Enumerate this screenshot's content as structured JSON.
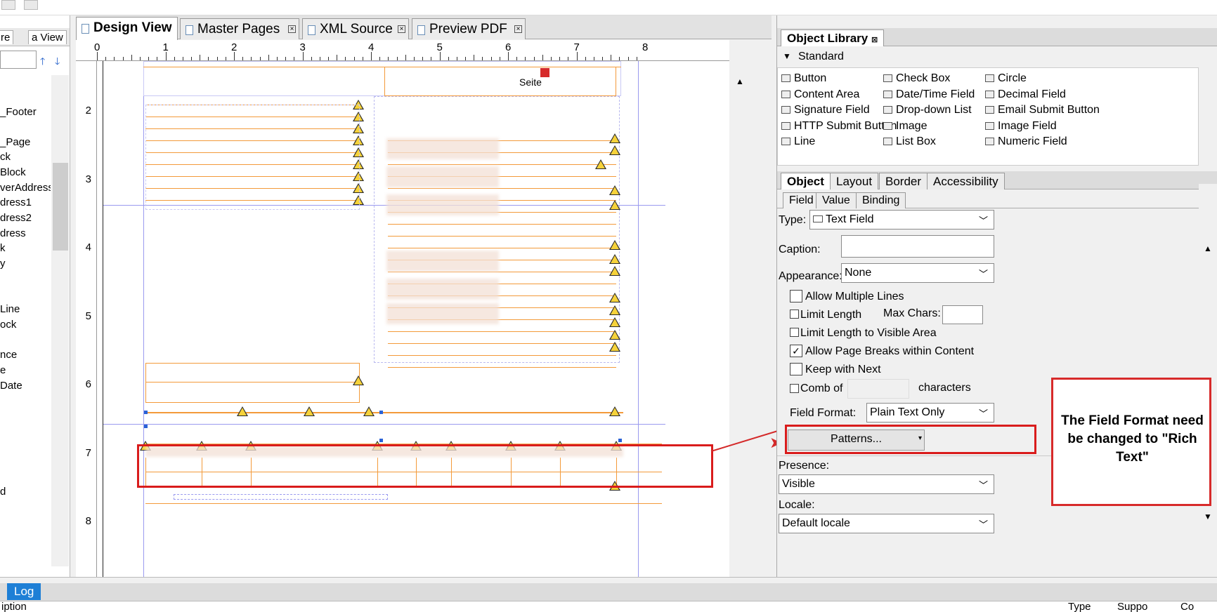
{
  "left_panel": {
    "tabs": [
      "re",
      "a View"
    ],
    "items": [
      "_Footer",
      "_Page",
      "ck",
      "Block",
      "verAddress",
      "dress1",
      "dress2",
      "dress",
      "k",
      "y",
      "Line",
      "ock",
      "nce",
      "e",
      "Date",
      "d"
    ]
  },
  "tabs": [
    {
      "label": "Design View",
      "active": true
    },
    {
      "label": "Master Pages",
      "active": false
    },
    {
      "label": "XML Source",
      "active": false
    },
    {
      "label": "Preview PDF",
      "active": false
    }
  ],
  "ruler": {
    "horizontal": [
      "0",
      "1",
      "2",
      "3",
      "4",
      "5",
      "6",
      "7",
      "8"
    ],
    "vertical": [
      "2",
      "3",
      "4",
      "5",
      "6",
      "7",
      "8"
    ]
  },
  "canvas": {
    "page_label": "Seite"
  },
  "callout": {
    "text": "The Field Format need be changed to \"Rich Text\""
  },
  "object_library": {
    "title": "Object Library",
    "section": "Standard",
    "items": [
      [
        "Button",
        "Check Box",
        "Circle"
      ],
      [
        "Content Area",
        "Date/Time Field",
        "Decimal Field"
      ],
      [
        "Signature Field",
        "Drop-down List",
        "Email Submit Button"
      ],
      [
        "HTTP Submit Button",
        "Image",
        "Image Field"
      ],
      [
        "Line",
        "List Box",
        "Numeric Field"
      ]
    ]
  },
  "object_panel": {
    "tabs": [
      "Object",
      "Layout",
      "Border",
      "Accessibility"
    ],
    "subtabs": [
      "Field",
      "Value",
      "Binding"
    ],
    "type_label": "Type:",
    "type_value": "Text Field",
    "caption_label": "Caption:",
    "caption_value": "",
    "appearance_label": "Appearance:",
    "appearance_value": "None",
    "allow_multiple_lines": {
      "label": "Allow Multiple Lines",
      "checked": false
    },
    "limit_length": {
      "label": "Limit Length",
      "checked": false
    },
    "max_chars_label": "Max Chars:",
    "max_chars_value": "",
    "limit_visible": {
      "label": "Limit Length to Visible Area",
      "checked": false
    },
    "allow_page_breaks": {
      "label": "Allow Page Breaks within Content",
      "checked": true
    },
    "keep_with_next": {
      "label": "Keep with Next",
      "checked": false
    },
    "comb_label": "Comb of",
    "comb_value": "",
    "characters_label": "characters",
    "field_format_label": "Field Format:",
    "field_format_value": "Plain Text Only",
    "patterns_label": "Patterns...",
    "presence_label": "Presence:",
    "presence_value": "Visible",
    "locale_label": "Locale:",
    "locale_value": "Default locale"
  },
  "bottom": {
    "log_tab": "Log",
    "columns": [
      "iption",
      "Type",
      "Suppo",
      "Co"
    ]
  }
}
